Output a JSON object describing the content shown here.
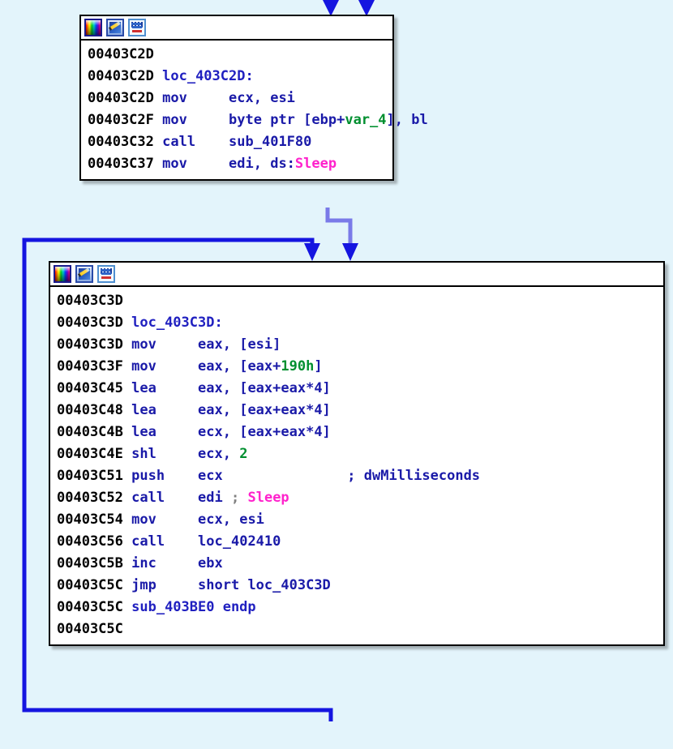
{
  "view": {
    "app": "IDA Pro graph view",
    "background_color": "#e3f4fb",
    "edge_color": "#1515e0",
    "edge_color_secondary": "#7a7ae8"
  },
  "toolbar": {
    "icons": [
      {
        "name": "color-palette-icon",
        "label": "Color palette"
      },
      {
        "name": "edit-pencil-icon",
        "label": "Edit"
      },
      {
        "name": "graph-chart-icon",
        "label": "Graph"
      }
    ]
  },
  "colors": {
    "address": "#000000",
    "instruction": "#1a1aa8",
    "label": "#2020c0",
    "number": "#008f2f",
    "variable": "#008f2f",
    "api": "#ff22cc",
    "comment": "#1a1aa8",
    "semicolon": "#808080"
  },
  "blocks": [
    {
      "id": "block-403c2d",
      "lines": [
        {
          "address": "00403C2D",
          "tokens": []
        },
        {
          "address": "00403C2D",
          "tokens": [
            {
              "t": "label",
              "v": "loc_403C2D:"
            }
          ]
        },
        {
          "address": "00403C2D",
          "tokens": [
            {
              "t": "instr",
              "v": "mov"
            },
            {
              "t": "pad",
              "v": "     "
            },
            {
              "t": "op",
              "v": "ecx, esi"
            }
          ]
        },
        {
          "address": "00403C2F",
          "tokens": [
            {
              "t": "instr",
              "v": "mov"
            },
            {
              "t": "pad",
              "v": "     "
            },
            {
              "t": "op",
              "v": "byte ptr [ebp+"
            },
            {
              "t": "var",
              "v": "var_4"
            },
            {
              "t": "op",
              "v": "], bl"
            }
          ]
        },
        {
          "address": "00403C32",
          "tokens": [
            {
              "t": "instr",
              "v": "call"
            },
            {
              "t": "pad",
              "v": "    "
            },
            {
              "t": "op",
              "v": "sub_401F80"
            }
          ]
        },
        {
          "address": "00403C37",
          "tokens": [
            {
              "t": "instr",
              "v": "mov"
            },
            {
              "t": "pad",
              "v": "     "
            },
            {
              "t": "op",
              "v": "edi, ds:"
            },
            {
              "t": "api",
              "v": "Sleep"
            }
          ]
        }
      ]
    },
    {
      "id": "block-403c3d",
      "lines": [
        {
          "address": "00403C3D",
          "tokens": []
        },
        {
          "address": "00403C3D",
          "tokens": [
            {
              "t": "label",
              "v": "loc_403C3D:"
            }
          ]
        },
        {
          "address": "00403C3D",
          "tokens": [
            {
              "t": "instr",
              "v": "mov"
            },
            {
              "t": "pad",
              "v": "     "
            },
            {
              "t": "op",
              "v": "eax, [esi]"
            }
          ]
        },
        {
          "address": "00403C3F",
          "tokens": [
            {
              "t": "instr",
              "v": "mov"
            },
            {
              "t": "pad",
              "v": "     "
            },
            {
              "t": "op",
              "v": "eax, [eax+"
            },
            {
              "t": "num",
              "v": "190h"
            },
            {
              "t": "op",
              "v": "]"
            }
          ]
        },
        {
          "address": "00403C45",
          "tokens": [
            {
              "t": "instr",
              "v": "lea"
            },
            {
              "t": "pad",
              "v": "     "
            },
            {
              "t": "op",
              "v": "eax, [eax+eax*4]"
            }
          ]
        },
        {
          "address": "00403C48",
          "tokens": [
            {
              "t": "instr",
              "v": "lea"
            },
            {
              "t": "pad",
              "v": "     "
            },
            {
              "t": "op",
              "v": "eax, [eax+eax*4]"
            }
          ]
        },
        {
          "address": "00403C4B",
          "tokens": [
            {
              "t": "instr",
              "v": "lea"
            },
            {
              "t": "pad",
              "v": "     "
            },
            {
              "t": "op",
              "v": "ecx, [eax+eax*4]"
            }
          ]
        },
        {
          "address": "00403C4E",
          "tokens": [
            {
              "t": "instr",
              "v": "shl"
            },
            {
              "t": "pad",
              "v": "     "
            },
            {
              "t": "op",
              "v": "ecx, "
            },
            {
              "t": "num",
              "v": "2"
            }
          ]
        },
        {
          "address": "00403C51",
          "tokens": [
            {
              "t": "instr",
              "v": "push"
            },
            {
              "t": "pad",
              "v": "    "
            },
            {
              "t": "op",
              "v": "ecx"
            },
            {
              "t": "pad",
              "v": "               "
            },
            {
              "t": "cmt",
              "v": "; dwMilliseconds"
            }
          ]
        },
        {
          "address": "00403C52",
          "tokens": [
            {
              "t": "instr",
              "v": "call"
            },
            {
              "t": "pad",
              "v": "    "
            },
            {
              "t": "op",
              "v": "edi "
            },
            {
              "t": "semi",
              "v": ";"
            },
            {
              "t": "op",
              "v": " "
            },
            {
              "t": "api",
              "v": "Sleep"
            }
          ]
        },
        {
          "address": "00403C54",
          "tokens": [
            {
              "t": "instr",
              "v": "mov"
            },
            {
              "t": "pad",
              "v": "     "
            },
            {
              "t": "op",
              "v": "ecx, esi"
            }
          ]
        },
        {
          "address": "00403C56",
          "tokens": [
            {
              "t": "instr",
              "v": "call"
            },
            {
              "t": "pad",
              "v": "    "
            },
            {
              "t": "op",
              "v": "loc_402410"
            }
          ]
        },
        {
          "address": "00403C5B",
          "tokens": [
            {
              "t": "instr",
              "v": "inc"
            },
            {
              "t": "pad",
              "v": "     "
            },
            {
              "t": "op",
              "v": "ebx"
            }
          ]
        },
        {
          "address": "00403C5C",
          "tokens": [
            {
              "t": "instr",
              "v": "jmp"
            },
            {
              "t": "pad",
              "v": "     "
            },
            {
              "t": "op",
              "v": "short loc_403C3D"
            }
          ]
        },
        {
          "address": "00403C5C",
          "tokens": [
            {
              "t": "label",
              "v": "sub_403BE0 endp"
            }
          ]
        },
        {
          "address": "00403C5C",
          "tokens": []
        }
      ]
    }
  ],
  "edges": [
    {
      "name": "incoming-edge-left",
      "from": "above",
      "to": "block-403c2d"
    },
    {
      "name": "incoming-edge-right",
      "from": "above",
      "to": "block-403c2d"
    },
    {
      "name": "fallthrough-edge",
      "from": "block-403c2d",
      "to": "block-403c3d"
    },
    {
      "name": "loop-back-edge",
      "from": "block-403c3d",
      "to": "block-403c3d"
    }
  ]
}
